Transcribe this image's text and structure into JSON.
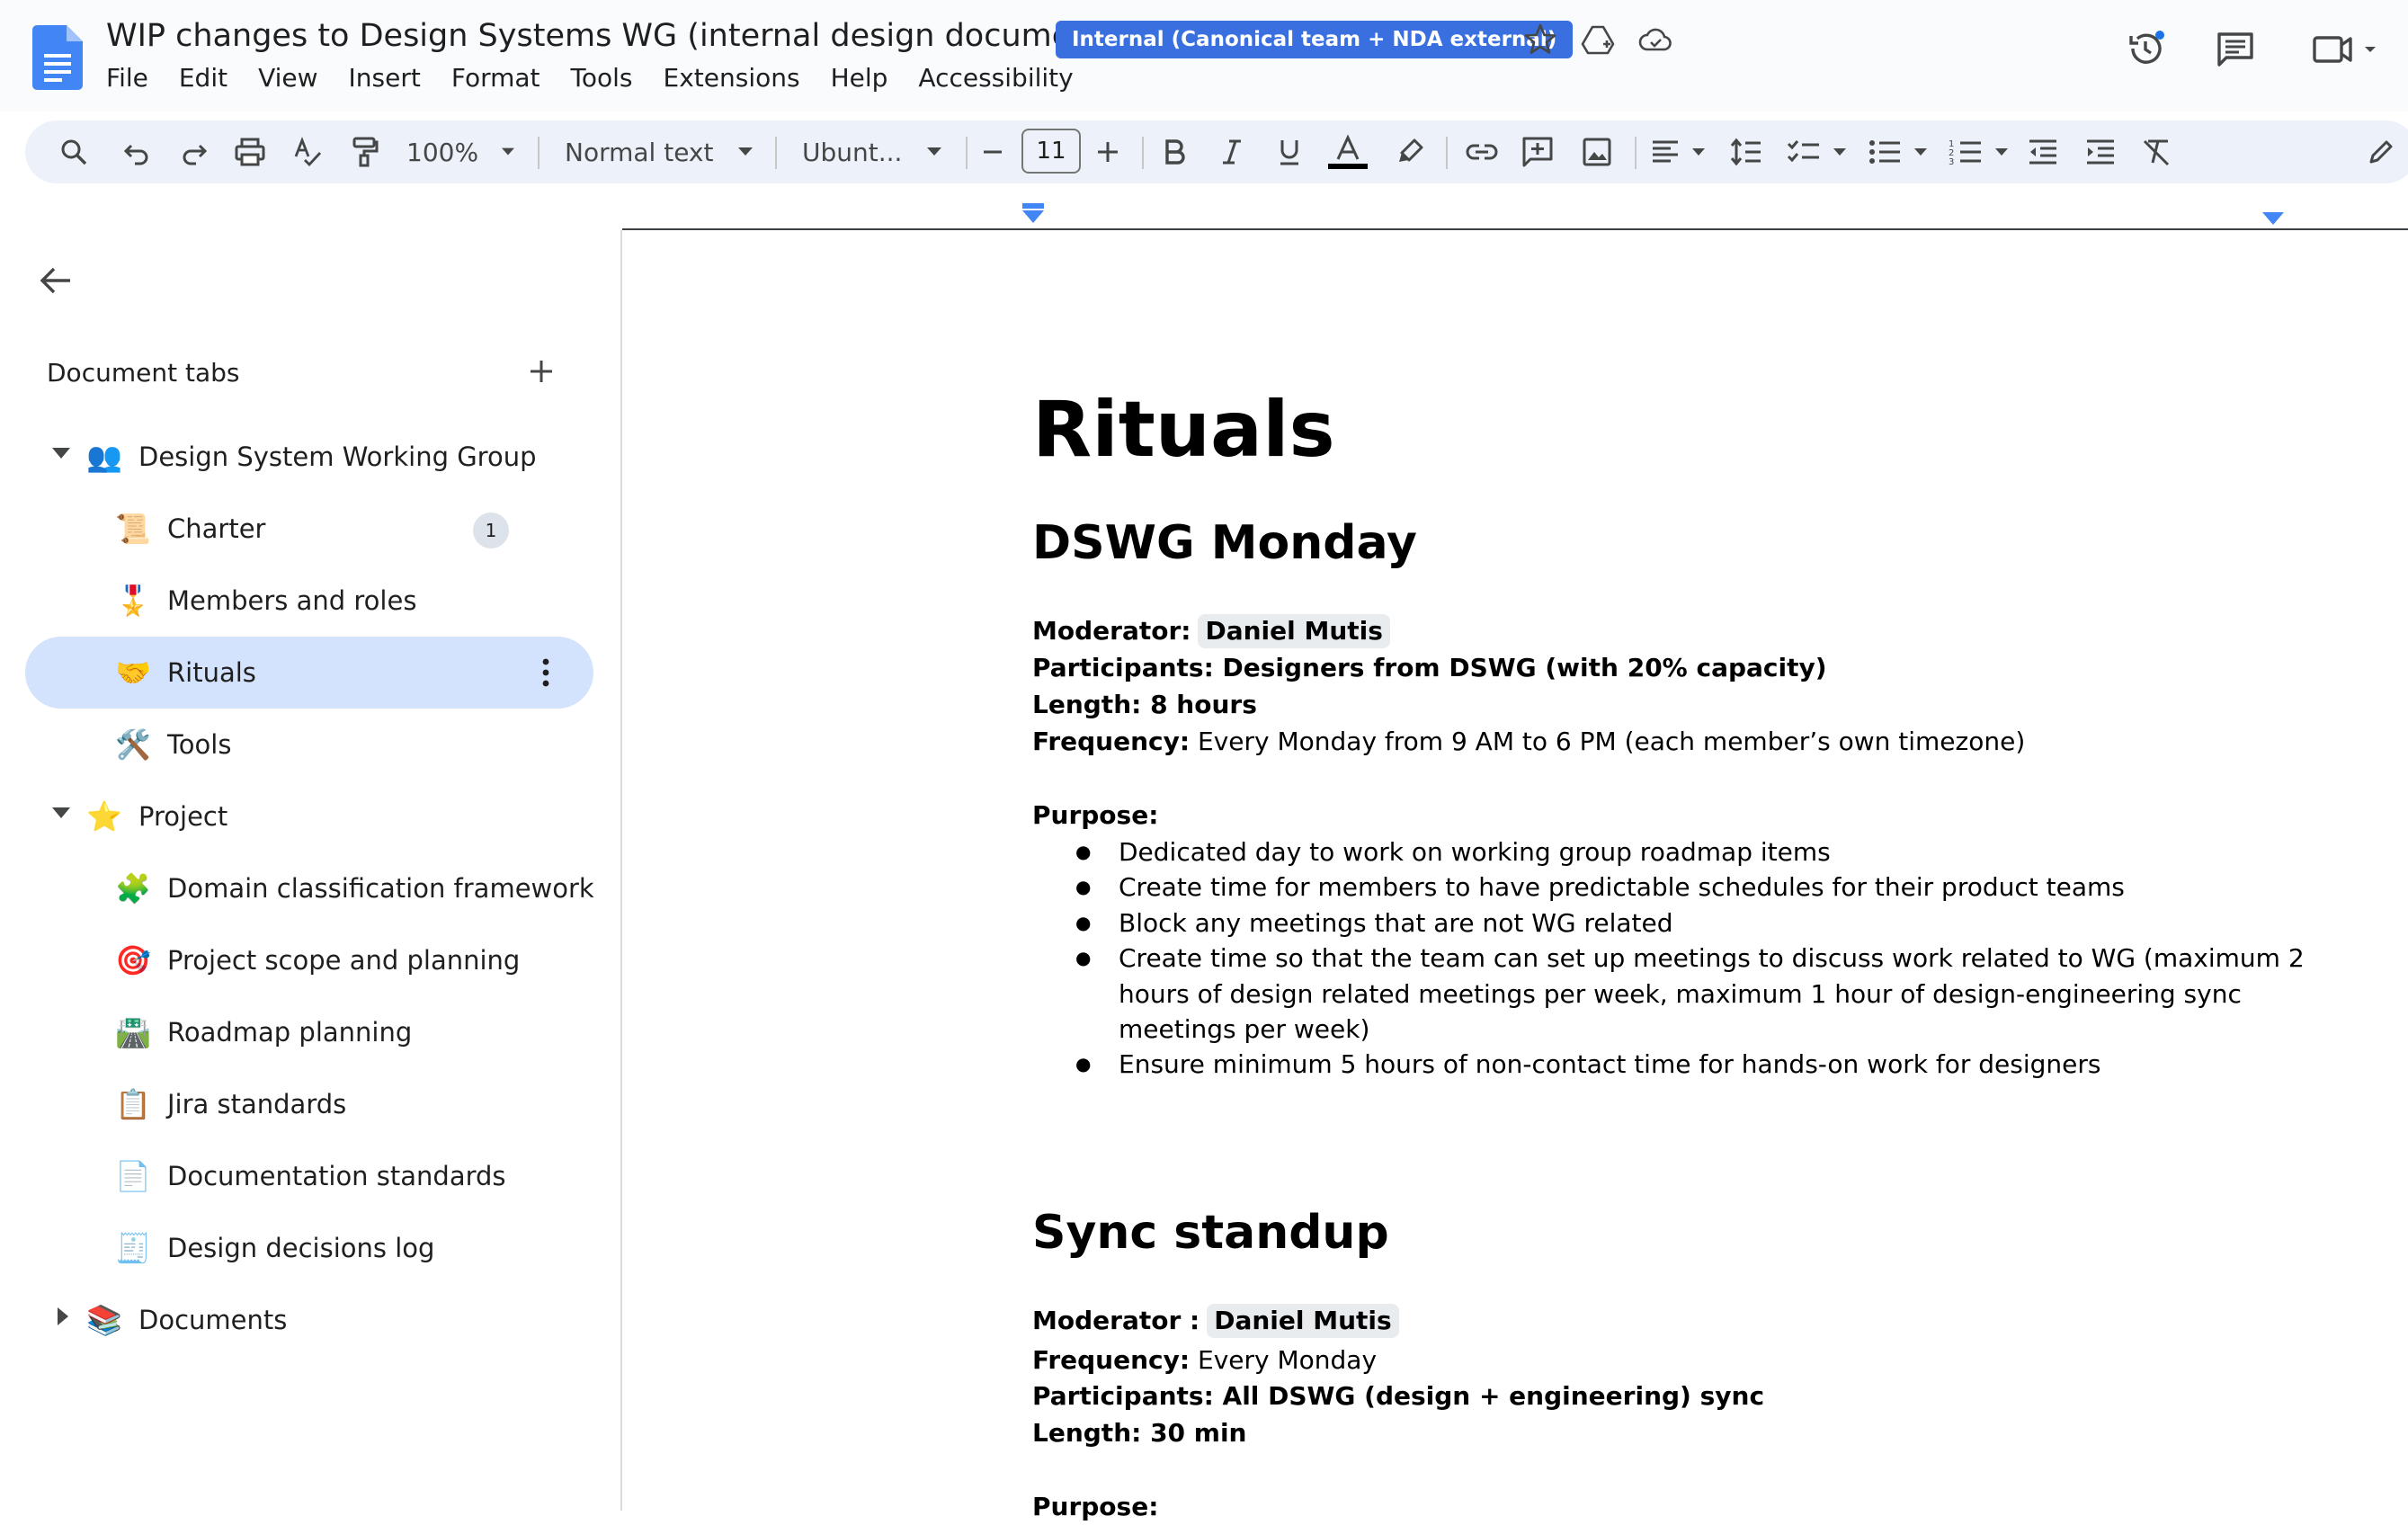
{
  "window": {
    "title": "WIP changes to Design Systems WG (internal design document)",
    "badge": "Internal (Canonical team + NDA external)"
  },
  "menu": [
    "File",
    "Edit",
    "View",
    "Insert",
    "Format",
    "Tools",
    "Extensions",
    "Help",
    "Accessibility"
  ],
  "toolbar": {
    "zoom": "100%",
    "style": "Normal text",
    "font": "Ubunt...",
    "font_size": "11",
    "colors": {
      "accent": "#3a6fe0",
      "toolbar_bg": "#edf2fa",
      "active_tab_bg": "#d3e3fd"
    }
  },
  "sidebar": {
    "title": "Document tabs",
    "items": [
      {
        "label": "Design System Working Group",
        "icon": "people-icon",
        "emoji": "👥"
      },
      {
        "label": "Charter",
        "icon": "scroll-icon",
        "emoji": "📜",
        "count": "1"
      },
      {
        "label": "Members and roles",
        "icon": "medal-icon",
        "emoji": "🎖️"
      },
      {
        "label": "Rituals",
        "icon": "handshake-icon",
        "emoji": "🤝"
      },
      {
        "label": "Tools",
        "icon": "tools-icon",
        "emoji": "🛠️"
      },
      {
        "label": "Project",
        "icon": "star-icon",
        "emoji": "⭐"
      },
      {
        "label": "Domain classification framework",
        "icon": "puzzle-icon",
        "emoji": "🧩"
      },
      {
        "label": "Project scope and planning",
        "icon": "target-icon",
        "emoji": "🎯"
      },
      {
        "label": "Roadmap planning",
        "icon": "road-icon",
        "emoji": "🛣️"
      },
      {
        "label": "Jira standards",
        "icon": "clipboard-icon",
        "emoji": "📋"
      },
      {
        "label": "Documentation standards",
        "icon": "page-icon",
        "emoji": "📄"
      },
      {
        "label": "Design decisions log",
        "icon": "document-icon",
        "emoji": "🧾"
      },
      {
        "label": "Documents",
        "icon": "books-icon",
        "emoji": "📚"
      }
    ]
  },
  "document": {
    "heading": "Rituals",
    "section1": {
      "title": "DSWG Monday",
      "moderator_label": "Moderator:",
      "moderator": "Daniel Mutis",
      "participants": "Participants: Designers from DSWG (with 20% capacity)",
      "length": "Length: 8 hours",
      "frequency_label": "Frequency:",
      "frequency": "Every Monday from 9 AM to 6 PM (each member’s own timezone)",
      "purpose_label": "Purpose:",
      "purpose": [
        "Dedicated day to work on working group roadmap items",
        "Create time for members to have predictable schedules for their product teams",
        "Block any meetings that are not WG related",
        "Create time so that the team can set up meetings to discuss work related to WG (maximum 2 hours of design related meetings per week, maximum 1 hour of design-engineering sync meetings per week)",
        "Ensure minimum 5 hours of non-contact time for hands-on work for designers"
      ]
    },
    "section2": {
      "title": "Sync standup",
      "moderator_label": "Moderator :",
      "moderator": "Daniel Mutis",
      "frequency_label": "Frequency:",
      "frequency": "Every Monday",
      "participants": "Participants: All DSWG (design + engineering) sync",
      "length": "Length: 30 min",
      "purpose_label": "Purpose:"
    }
  }
}
